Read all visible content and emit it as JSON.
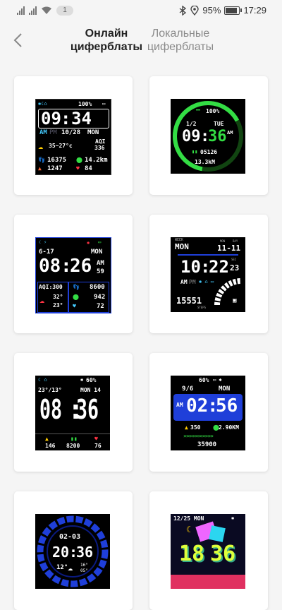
{
  "status_bar": {
    "notification_count": "1",
    "battery": "95%",
    "battery_level": 0.95,
    "time": "17:29"
  },
  "header": {
    "tab_online": "Онлайн\nциферблаты",
    "tab_local": "Локальные\nциферблаты",
    "tab_online_l1": "Онлайн",
    "tab_online_l2": "циферблаты",
    "tab_local_l1": "Локальные",
    "tab_local_l2": "циферблаты"
  },
  "faces": [
    {
      "battery": "100%",
      "time_h": "09",
      "time_m": "34",
      "ampm_am": "AM",
      "ampm_pm": "PM",
      "date": "10/28",
      "weekday": "MON",
      "temp": "35~27°c",
      "aqi_label": "AQI",
      "aqi": "336",
      "steps": "16375",
      "distance": "14.2km",
      "calories": "1247",
      "heart": "84"
    },
    {
      "battery": "100%",
      "page": "1/2",
      "weekday": "TUE",
      "time_h": "09",
      "time_m": "36",
      "ampm": "AM",
      "steps": "05126",
      "distance": "13.3kM"
    },
    {
      "date": "6-17",
      "weekday": "MON",
      "time_h": "08",
      "time_m": "26",
      "ampm": "AM",
      "sec": "59",
      "aqi": "AQI:300",
      "steps": "8600",
      "temp_hi": "32°",
      "temp_lo": "23°",
      "distance": "942",
      "heart": "72"
    },
    {
      "week_label": "WEEK",
      "weekday": "MON",
      "mon_label": "MON",
      "day_label": "DAY",
      "date": "11-11",
      "time_h": "10",
      "time_m": "22",
      "sec_label": "SEC",
      "sec": "23",
      "ampm_am": "AM",
      "ampm_pm": "PM",
      "steps": "15551",
      "steps_label": "STEPS"
    },
    {
      "battery": "60%",
      "temp": "23°/13°",
      "date": "MON 14",
      "time_h": "08",
      "time_m": "36",
      "calories": "146",
      "steps": "8200",
      "heart": "76"
    },
    {
      "battery": "60%",
      "date": "9/6",
      "weekday": "MON",
      "ampm": "AM",
      "time_h": "02",
      "time_m": "56",
      "calories": "350",
      "distance": "2.90KM",
      "steps": "35900"
    },
    {
      "date": "02-03",
      "time_h": "20",
      "time_m": "36",
      "temp_now": "12°",
      "temp_hi": "16°",
      "temp_lo": "05°"
    },
    {
      "date": "12/25 MON",
      "time_h": "18",
      "time_m": "36"
    }
  ],
  "colors": {
    "accent_green": "#33dd44",
    "cyan": "#22ddee",
    "blue": "#1f3fd9",
    "yellow": "#ffcc00",
    "red": "#ff3344"
  }
}
